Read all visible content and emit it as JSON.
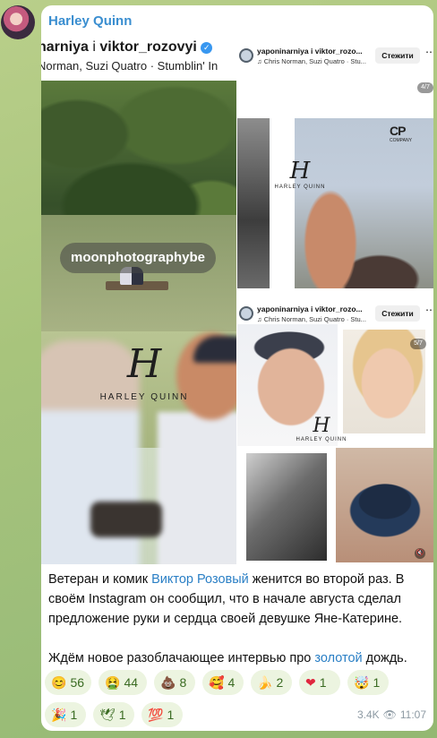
{
  "channel": {
    "name": "Harley Quinn"
  },
  "story": {
    "names_prefix": "narniya",
    "names_joiner": "і",
    "names_user": "viktor_rozovyi",
    "music": "Norman, Suzi Quatro · Stumblin' In",
    "tag": "moonphotographybe",
    "logo_word": "HARLEY QUINN"
  },
  "insta_post_1": {
    "title": "yaponinarniya і viktor_rozo...",
    "subtitle": "♫ Chris Norman, Suzi Quatro · Stu...",
    "follow_label": "Стежити",
    "counter": "4/7",
    "brand": "CP",
    "brand_sub": "COMPANY",
    "logo_word": "HARLEY QUINN"
  },
  "insta_post_2": {
    "title": "yaponinarniya і viktor_rozo...",
    "subtitle": "♫ Chris Norman, Suzi Quatro · Stu...",
    "follow_label": "Стежити",
    "counter": "5/7",
    "logo_word": "HARLEY QUINN"
  },
  "caption": {
    "p1_before": "Ветеран и комик ",
    "p1_link": "Виктор Розовый",
    "p1_after": " женится во второй раз. В своём Instagram он сообщил, что в начале августа сделал предложение руки и сердца своей девушке Яне-Катерине.",
    "p2_before": "Ждём новое разоблачающее интервью про ",
    "p2_link": "золотой",
    "p2_after": " дождь."
  },
  "reactions": [
    {
      "emoji": "😊",
      "count": "56"
    },
    {
      "emoji": "🤮",
      "count": "44"
    },
    {
      "emoji": "💩",
      "count": "8"
    },
    {
      "emoji": "🥰",
      "count": "4"
    },
    {
      "emoji": "🍌",
      "count": "2"
    },
    {
      "emoji": "❤",
      "count": "1"
    },
    {
      "emoji": "🤯",
      "count": "1"
    },
    {
      "emoji": "🎉",
      "count": "1"
    },
    {
      "emoji": "🕊",
      "count": "1"
    },
    {
      "emoji": "💯",
      "count": "1"
    }
  ],
  "meta": {
    "views": "3.4K",
    "time": "11:07"
  }
}
